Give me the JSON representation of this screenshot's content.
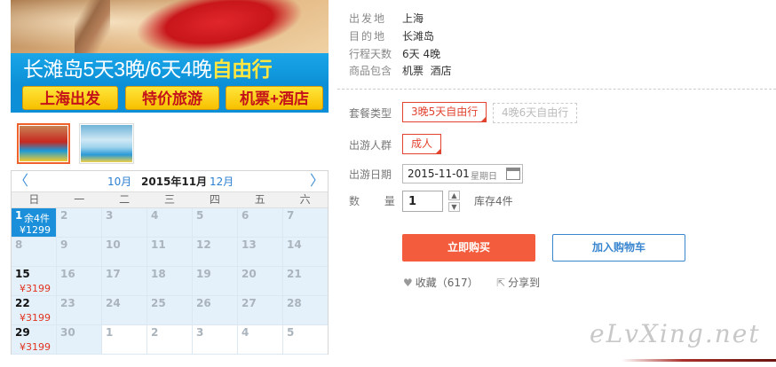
{
  "banner": {
    "title_prefix": "长滩岛",
    "title_mid": "5天3晚/6天4晚",
    "title_suffix": "自由行",
    "tags": [
      "上海出发",
      "特价旅游",
      "机票+酒店"
    ]
  },
  "calendar": {
    "prev_arrow": "〈",
    "next_arrow": "〉",
    "prev_month": "10月",
    "current_month": "2015年11月",
    "next_month": "12月",
    "weekdays": [
      "日",
      "一",
      "二",
      "三",
      "四",
      "五",
      "六"
    ],
    "rows": [
      [
        {
          "n": "1",
          "stock": "余4件",
          "price": "¥1299"
        },
        {
          "n": "2"
        },
        {
          "n": "3"
        },
        {
          "n": "4"
        },
        {
          "n": "5"
        },
        {
          "n": "6"
        },
        {
          "n": "7"
        }
      ],
      [
        {
          "n": "8"
        },
        {
          "n": "9"
        },
        {
          "n": "10"
        },
        {
          "n": "11"
        },
        {
          "n": "12"
        },
        {
          "n": "13"
        },
        {
          "n": "14"
        }
      ],
      [
        {
          "n": "15",
          "price": "¥3199"
        },
        {
          "n": "16"
        },
        {
          "n": "17"
        },
        {
          "n": "18"
        },
        {
          "n": "19"
        },
        {
          "n": "20"
        },
        {
          "n": "21"
        }
      ],
      [
        {
          "n": "22",
          "price": "¥3199"
        },
        {
          "n": "23"
        },
        {
          "n": "24"
        },
        {
          "n": "25"
        },
        {
          "n": "26"
        },
        {
          "n": "27"
        },
        {
          "n": "28"
        }
      ],
      [
        {
          "n": "29",
          "price": "¥3199"
        },
        {
          "n": "30"
        },
        {
          "n": "1"
        },
        {
          "n": "2"
        },
        {
          "n": "3"
        },
        {
          "n": "4"
        },
        {
          "n": "5"
        }
      ]
    ]
  },
  "info": {
    "departure_label": "出发地",
    "departure_value": "上海",
    "destination_label": "目的地",
    "destination_value": "长滩岛",
    "days_label": "行程天数",
    "days_value": "6天 4晚",
    "includes_label": "商品包含",
    "includes_value": "机票  酒店"
  },
  "options": {
    "package_label": "套餐类型",
    "package_selected": "3晚5天自由行",
    "package_other": "4晚6天自由行",
    "people_label": "出游人群",
    "people_selected": "成人",
    "date_label": "出游日期",
    "date_value": "2015-11-01",
    "date_weekday": "星期日",
    "qty_label": "数  量",
    "qty_value": "1",
    "qty_up": "▲",
    "qty_down": "▼",
    "stock_text": "库存4件"
  },
  "actions": {
    "buy_now": "立即购买",
    "add_cart": "加入购物车",
    "favorite_icon_glyph": "♥",
    "favorite_label": "收藏（617）",
    "share_icon_glyph": "⇱",
    "share_label": "分享到"
  },
  "watermark": "eLvXing.net",
  "colors": {
    "accent_red": "#f35c3d",
    "link_blue": "#3a86cf",
    "calendar_selected": "#1b8fd9"
  }
}
